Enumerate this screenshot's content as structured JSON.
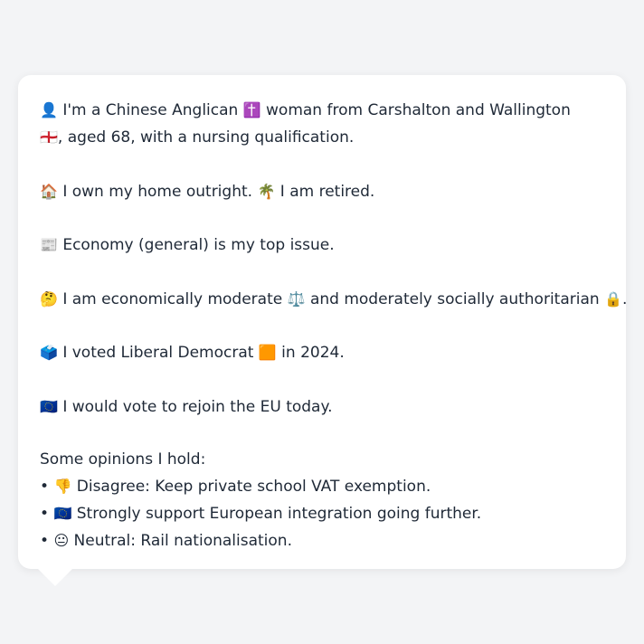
{
  "profile": {
    "intro": {
      "person_icon": "👤",
      "text_a": " I'm a Chinese Anglican ",
      "religion_icon": "✝️",
      "text_b": " woman from Carshalton and Wallington ",
      "flag_icon": "🏴󠁧󠁢󠁥󠁮󠁧󠁿",
      "text_c": ", aged 68, with a nursing qualification."
    },
    "home": {
      "house_icon": "🏠",
      "text_a": " I own my home outright. ",
      "palm_icon": "🌴",
      "text_b": " I am retired."
    },
    "issue": {
      "newspaper_icon": "📰",
      "text": " Economy (general) is my top issue."
    },
    "ideology": {
      "thinking_icon": "🤔",
      "text_a": " I am economically moderate ",
      "scales_icon": "⚖️",
      "text_b": " and moderately socially authoritarian ",
      "lock_icon": "🔒",
      "text_c": "."
    },
    "vote": {
      "ballot_icon": "🗳️",
      "text_a": " I voted Liberal Democrat ",
      "party_icon": "🟧",
      "text_b": " in 2024."
    },
    "eu": {
      "eu_flag_icon": "🇪🇺",
      "text": " I would vote to rejoin the EU today."
    },
    "opinions_heading": "Some opinions I hold:",
    "opinions": [
      {
        "bullet": "• ",
        "icon": "👎",
        "text": " Disagree: Keep private school VAT exemption."
      },
      {
        "bullet": "• ",
        "icon": "🇪🇺",
        "text": " Strongly support European integration going further."
      },
      {
        "bullet": "• ",
        "icon": "😐",
        "text": " Neutral: Rail nationalisation."
      }
    ]
  }
}
